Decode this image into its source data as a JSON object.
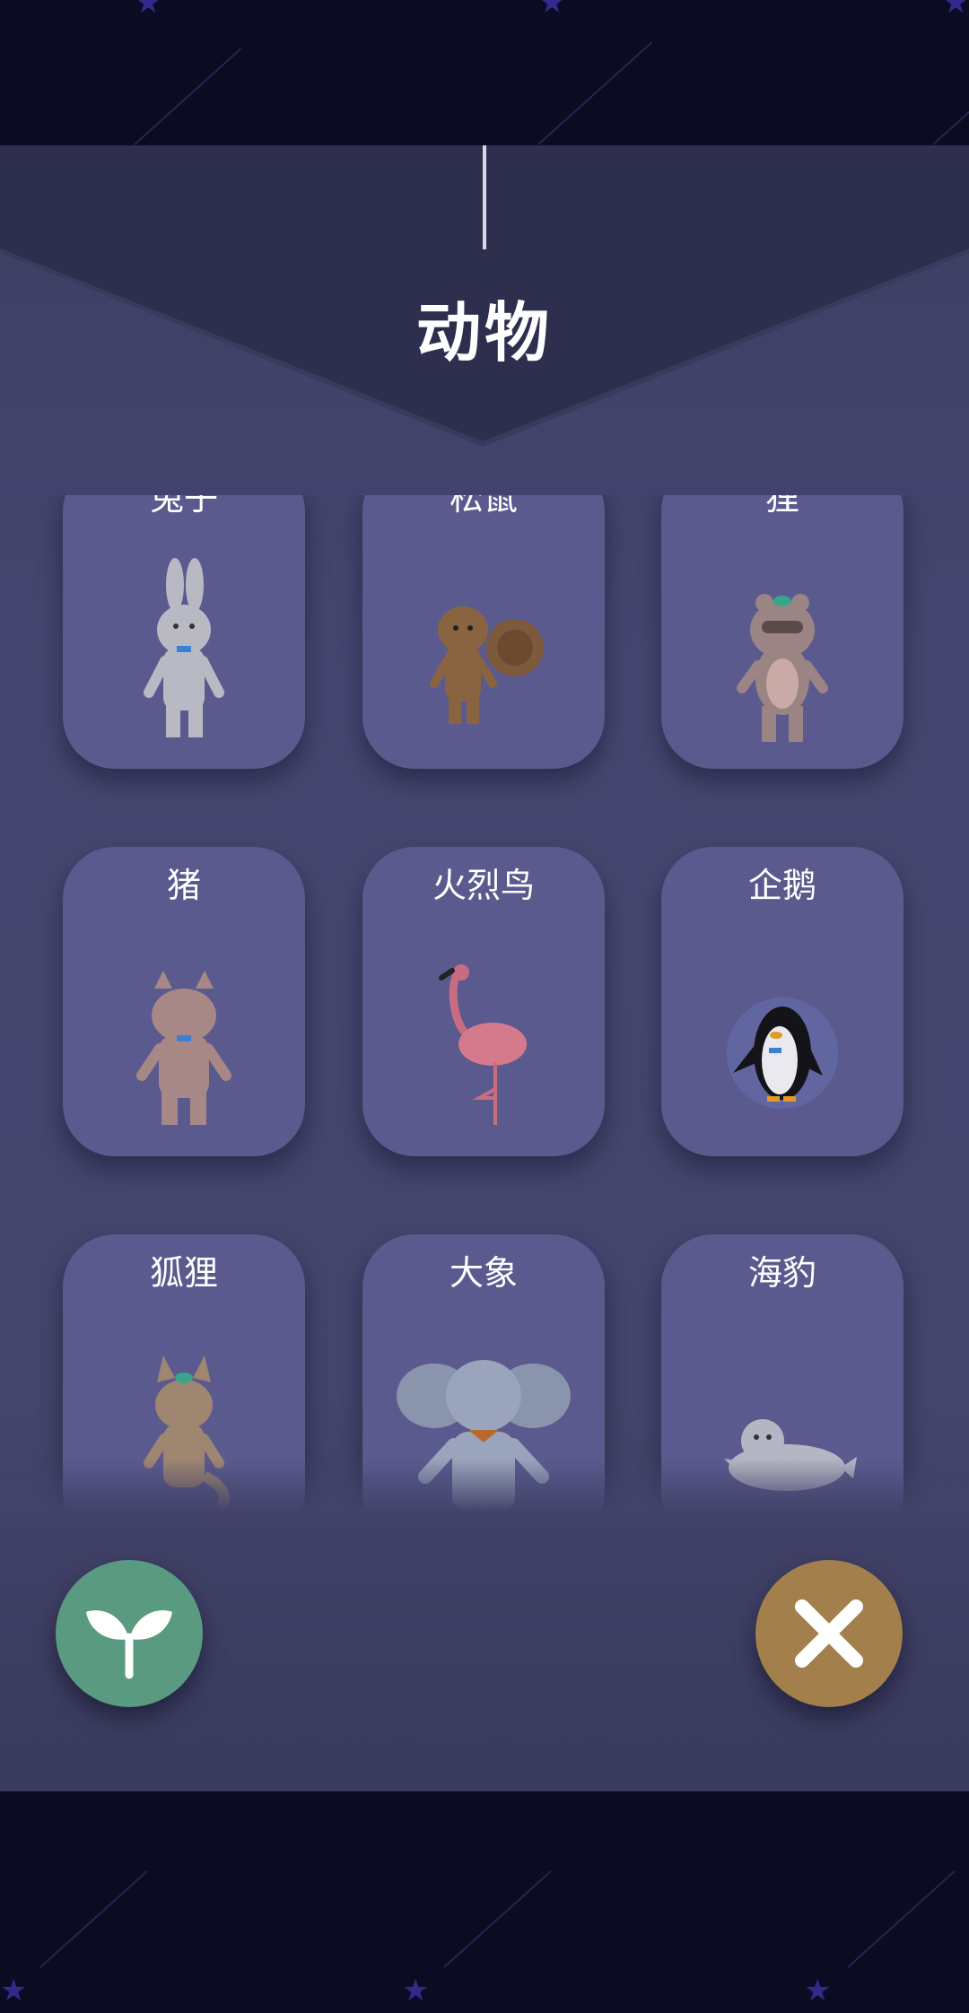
{
  "screen": {
    "title": "动物"
  },
  "animals": [
    {
      "name": "兔子",
      "icon": "rabbit-icon"
    },
    {
      "name": "松鼠",
      "icon": "squirrel-icon"
    },
    {
      "name": "狸",
      "icon": "raccoon-dog-icon"
    },
    {
      "name": "猪",
      "icon": "pig-icon"
    },
    {
      "name": "火烈鸟",
      "icon": "flamingo-icon"
    },
    {
      "name": "企鹅",
      "icon": "penguin-icon"
    },
    {
      "name": "狐狸",
      "icon": "fox-icon"
    },
    {
      "name": "大象",
      "icon": "elephant-icon"
    },
    {
      "name": "海豹",
      "icon": "seal-icon"
    }
  ],
  "actions": {
    "sprout": {
      "icon": "sprout-icon",
      "color": "#5a9a80"
    },
    "close": {
      "icon": "close-icon",
      "color": "#a3804b"
    }
  },
  "colors": {
    "background": "#0b0b22",
    "panel": "#44446c",
    "card": "#5a5a8e",
    "text": "#ffffff"
  }
}
